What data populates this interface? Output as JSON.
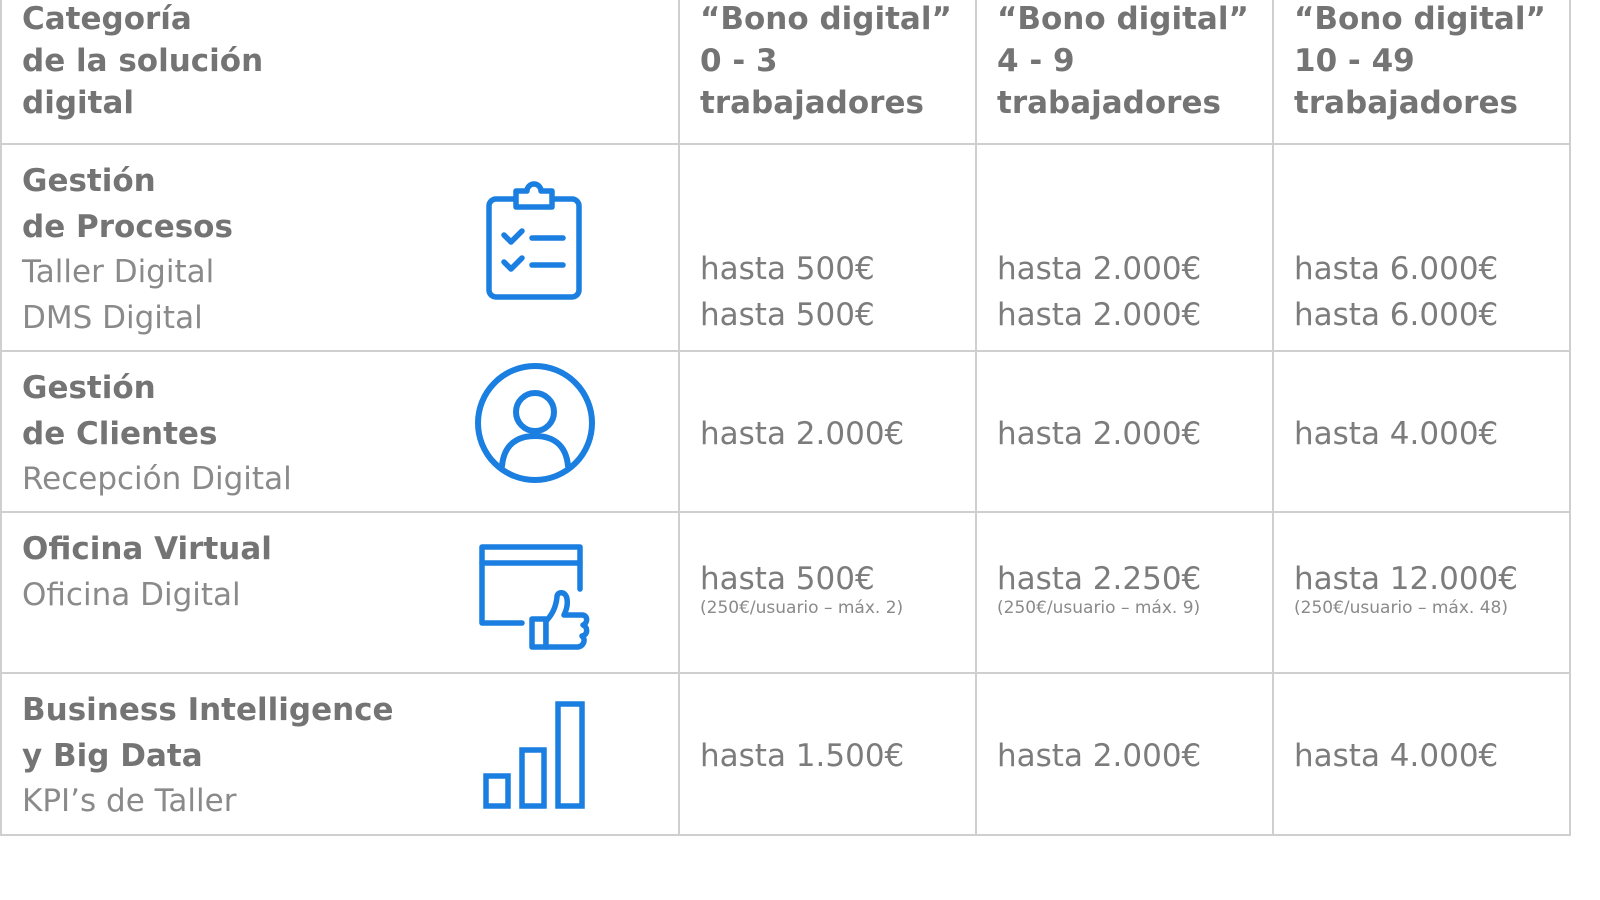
{
  "header": {
    "category": [
      "Categoría",
      "de la solución",
      "digital"
    ],
    "tiers": [
      [
        "“Bono digital”",
        "0 - 3",
        "trabajadores"
      ],
      [
        "“Bono digital”",
        "4 - 9",
        "trabajadores"
      ],
      [
        "“Bono digital”",
        "10 - 49",
        "trabajadores"
      ]
    ]
  },
  "rows": [
    {
      "title": [
        "Gestión",
        "de Procesos"
      ],
      "subs": [
        "Taller Digital",
        "DMS Digital"
      ],
      "icon": "clipboard-checklist-icon",
      "values": [
        [
          "hasta 500€",
          "hasta 500€"
        ],
        [
          "hasta 2.000€",
          "hasta 2.000€"
        ],
        [
          "hasta 6.000€",
          "hasta 6.000€"
        ]
      ]
    },
    {
      "title": [
        "Gestión",
        "de Clientes"
      ],
      "subs": [
        "Recepción Digital"
      ],
      "icon": "user-circle-icon",
      "values": [
        [
          "hasta 2.000€"
        ],
        [
          "hasta 2.000€"
        ],
        [
          "hasta 4.000€"
        ]
      ]
    },
    {
      "title": [
        "Oficina Virtual"
      ],
      "subs": [
        "Oficina Digital"
      ],
      "icon": "browser-thumbs-up-icon",
      "values": [
        [
          "hasta 500€"
        ],
        [
          "hasta 2.250€"
        ],
        [
          "hasta 12.000€"
        ]
      ],
      "notes": [
        "(250€/usuario – máx. 2)",
        "(250€/usuario – máx. 9)",
        "(250€/usuario – máx. 48)"
      ]
    },
    {
      "title": [
        "Business Intelligence",
        "y Big Data"
      ],
      "subs": [
        "KPI’s de Taller"
      ],
      "icon": "bar-chart-icon",
      "values": [
        [
          "hasta 1.500€"
        ],
        [
          "hasta 2.000€"
        ],
        [
          "hasta 4.000€"
        ]
      ]
    }
  ],
  "colors": {
    "icon": "#1a7fe0",
    "text": "#7b7b7b",
    "border": "#cfcfcf"
  }
}
